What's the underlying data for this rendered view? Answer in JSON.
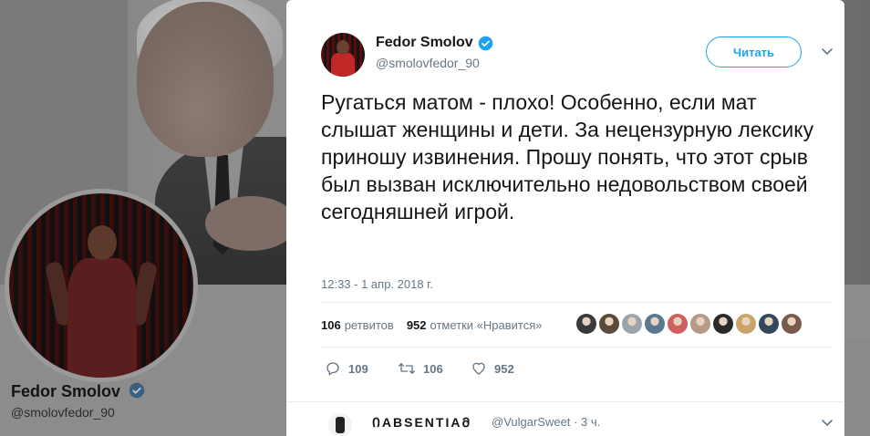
{
  "background_profile": {
    "name": "Fedor Smolov",
    "handle": "@smolovfedor_90"
  },
  "tweet": {
    "author_name": "Fedor Smolov",
    "author_handle": "@smolovfedor_90",
    "follow_label": "Читать",
    "text": "Ругаться матом - плохо! Особенно, если мат слышат женщины и дети. За нецензурную лексику приношу извинения. Прошу понять, что этот срыв был вызван исключительно недовольством своей сегодняшней игрой.",
    "timestamp": "12:33 - 1 апр. 2018 г.",
    "retweets_count": "106",
    "retweets_label": "ретвитов",
    "likes_count": "952",
    "likes_label": "отметки «Нравится»",
    "liker_colors": [
      "#3a3a3a",
      "#5c4a3a",
      "#9aa4ad",
      "#5a7890",
      "#d06060",
      "#b59a8a",
      "#2a2a2a",
      "#caa36b",
      "#33485a",
      "#7a5a4a"
    ],
    "actions": {
      "replies": "109",
      "retweets": "106",
      "likes": "952"
    },
    "verified_color": "#1da1f2"
  },
  "reply": {
    "name": "ᲘABSENTIAᲛ",
    "handle": "@VulgarSweet · 3 ч."
  }
}
